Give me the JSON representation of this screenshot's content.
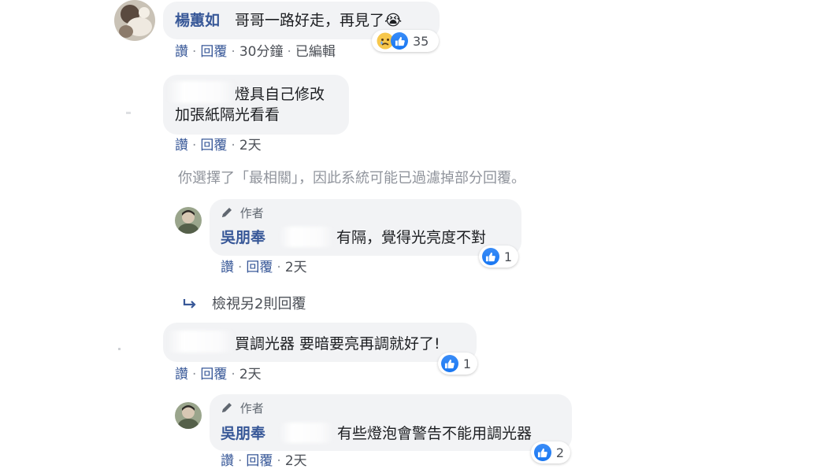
{
  "comments": [
    {
      "author": "楊蕙如",
      "text": "哥哥一路好走，再見了😭",
      "actions": {
        "like": "讚",
        "reply": "回覆",
        "time": "30分鐘",
        "edited": "已編輯"
      },
      "reactions": {
        "icons": [
          "sad-icon",
          "like-icon"
        ],
        "count": "35"
      }
    },
    {
      "author": "",
      "text_line1": "燈具自己修改",
      "text_line2": "加張紙隔光看看",
      "actions": {
        "like": "讚",
        "reply": "回覆",
        "time": "2天"
      }
    }
  ],
  "filter_notice": "你選擇了「最相關」，因此系統可能已過濾掉部分回覆。",
  "replies": [
    {
      "author_badge": "作者",
      "author": "吳朋奉",
      "text": "有隔，覺得光亮度不對",
      "actions": {
        "like": "讚",
        "reply": "回覆",
        "time": "2天"
      },
      "reactions": {
        "count": "1"
      }
    },
    {
      "author_badge": "作者",
      "author": "吳朋奉",
      "text": "有些燈泡會警告不能用調光器",
      "actions": {
        "like": "讚",
        "reply": "回覆",
        "time": "2天"
      },
      "reactions": {
        "count": "2"
      }
    }
  ],
  "view_more_replies": "檢視另2則回覆",
  "comment3": {
    "text": "買調光器 要暗要亮再調就好了!",
    "actions": {
      "like": "讚",
      "reply": "回覆",
      "time": "2天"
    },
    "reactions": {
      "count": "1"
    }
  },
  "colors": {
    "link": "#385898",
    "bubble": "#f2f3f5",
    "like_blue": "#1877f2",
    "muted": "#90949c"
  }
}
